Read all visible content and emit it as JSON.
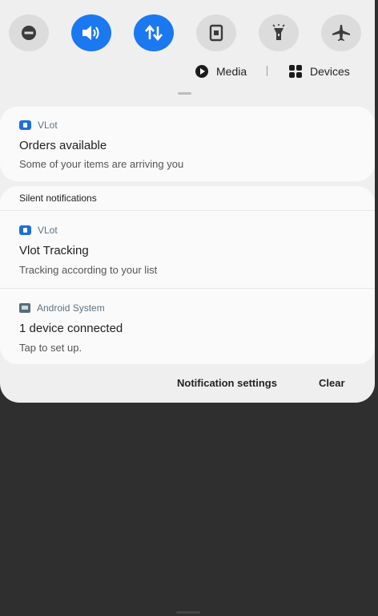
{
  "quick_settings": [
    {
      "name": "do-not-disturb",
      "icon": "minus-circle-icon",
      "state": "off"
    },
    {
      "name": "sound",
      "icon": "speaker-icon",
      "state": "on"
    },
    {
      "name": "mobile-data",
      "icon": "data-arrows-icon",
      "state": "on"
    },
    {
      "name": "screen-off",
      "icon": "phone-icon",
      "state": "off"
    },
    {
      "name": "flashlight",
      "icon": "flashlight-icon",
      "state": "off"
    },
    {
      "name": "airplane-mode",
      "icon": "airplane-icon",
      "state": "off"
    }
  ],
  "media_bar": {
    "media_label": "Media",
    "devices_label": "Devices"
  },
  "notifications": [
    {
      "app": "VLot",
      "title": "Orders available",
      "body": "Some of your items are arriving you"
    }
  ],
  "silent_section": {
    "label": "Silent notifications",
    "items": [
      {
        "app": "VLot",
        "title": "Vlot Tracking",
        "body": "Tracking according to your list"
      },
      {
        "app": "Android System",
        "title": "1 device connected",
        "body": "Tap to set up."
      }
    ]
  },
  "actions": {
    "settings_label": "Notification settings",
    "clear_label": "Clear"
  },
  "colors": {
    "accent": "#1a78f0",
    "shade_background": "#efefef",
    "card_background": "#fafafa",
    "backdrop": "#2f2f2f"
  }
}
